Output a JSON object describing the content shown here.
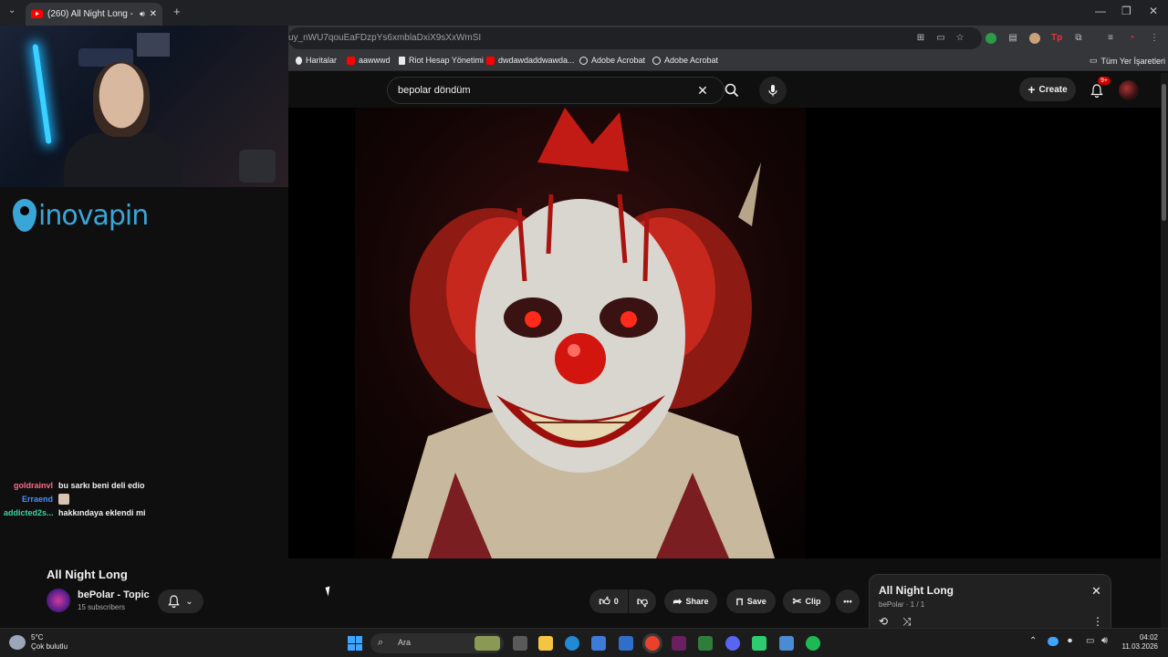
{
  "browser": {
    "tab_title": "(260) All Night Long - YouTube",
    "url": "uy_nWU7qouEaFDzpYs6xmblaDxiX9sXxWmSI",
    "bookmarks": [
      "Haritalar",
      "aawwwd",
      "Riot Hesap Yönetimi",
      "dwdawdaddwawda...",
      "Adobe Acrobat",
      "Adobe Acrobat"
    ],
    "bookmarks_all": "Tüm Yer İşaretleri"
  },
  "youtube": {
    "search_value": "bepolar döndüm",
    "create_label": "Create",
    "notifications_badge": "9+"
  },
  "stream_overlay": {
    "sponsor": "inovapin",
    "chat": [
      {
        "user": "goldrainvl",
        "message": "bu sarkı beni deli edio",
        "color": "#ff6b8a"
      },
      {
        "user": "Erraend",
        "message": "",
        "color": "#4a8cff"
      },
      {
        "user": "addicted2s...",
        "message": "hakkındaya eklendi mi",
        "color": "#3ad6a0"
      }
    ]
  },
  "video": {
    "title": "All Night Long",
    "channel": "bePolar - Topic",
    "subscribers": "15 subscribers",
    "likes": "0",
    "share_label": "Share",
    "save_label": "Save",
    "clip_label": "Clip"
  },
  "playlist": {
    "title": "All Night Long",
    "subtitle": "bePolar · 1 / 1"
  },
  "taskbar": {
    "weather_temp": "5°C",
    "weather_desc": "Çok bulutlu",
    "search_placeholder": "Ara",
    "time": "04:02",
    "date": "11.03.2026"
  }
}
